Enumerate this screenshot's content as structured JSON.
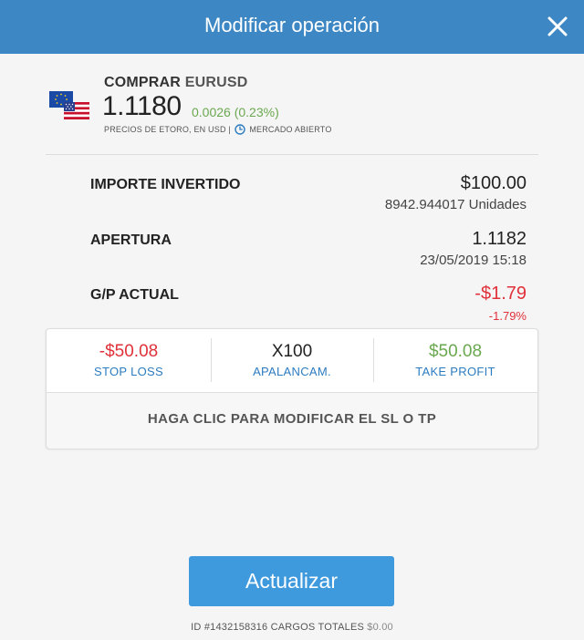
{
  "header": {
    "title": "Modificar operación",
    "close_icon": "close-icon"
  },
  "instrument": {
    "action": "COMPRAR",
    "symbol": "EURUSD",
    "price": "1.1180",
    "change": "0.0026 (0.23%)",
    "prices_note": "PRECIOS DE ETORO, EN USD",
    "separator": "|",
    "market_status": "MERCADO ABIERTO",
    "flag_icon": "eur-usd-flags-icon",
    "change_color": "#6aa84f"
  },
  "details": {
    "invested": {
      "label": "IMPORTE INVERTIDO",
      "value": "$100.00",
      "sub": "8942.944017 Unidades"
    },
    "open": {
      "label": "APERTURA",
      "value": "1.1182",
      "sub": "23/05/2019 15:18"
    },
    "pnl": {
      "label": "G/P ACTUAL",
      "value": "-$1.79",
      "sub": "-1.79%",
      "color": "#e0313a"
    }
  },
  "sltp": {
    "stop_loss": {
      "value": "-$50.08",
      "label": "STOP LOSS",
      "color": "#e0313a"
    },
    "leverage": {
      "value": "X100",
      "label": "APALANCAM."
    },
    "take_profit": {
      "value": "$50.08",
      "label": "TAKE PROFIT",
      "color": "#6aa84f"
    },
    "cta": "HAGA CLIC PARA MODIFICAR EL SL O TP"
  },
  "update_button": {
    "label": "Actualizar",
    "color": "#3f99dd"
  },
  "footer": {
    "id_text": "ID #1432158316 CARGOS TOTALES",
    "fee": "$0.00"
  },
  "colors": {
    "header": "#3d88c4",
    "link": "#2c7cc0"
  }
}
